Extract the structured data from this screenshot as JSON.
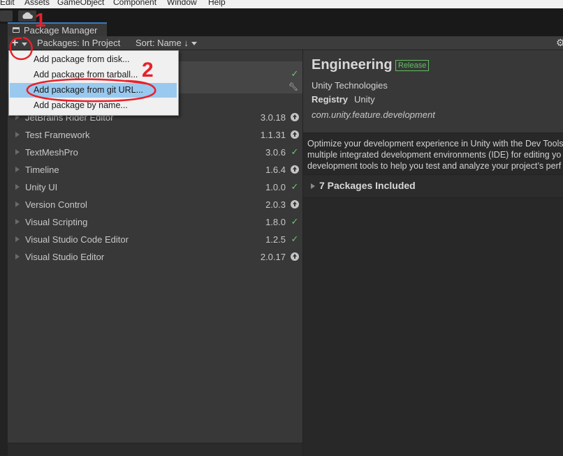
{
  "menubar": {
    "items": [
      "Edit",
      "Assets",
      "GameObject",
      "Component",
      "Window",
      "Help"
    ]
  },
  "window": {
    "title": "Package Manager"
  },
  "toolbar": {
    "add_label": "+",
    "packages_filter": "Packages: In Project",
    "sort_label": "Sort: Name ↓"
  },
  "menu": {
    "items": [
      {
        "label": "Add package from disk...",
        "highlighted": false
      },
      {
        "label": "Add package from tarball...",
        "highlighted": false
      },
      {
        "label": "Add package from git URL...",
        "highlighted": true
      },
      {
        "label": "Add package by name...",
        "highlighted": false
      }
    ]
  },
  "packages": [
    {
      "name": "JetBrains Rider Editor",
      "version": "3.0.18",
      "status": "update-icon"
    },
    {
      "name": "Test Framework",
      "version": "1.1.31",
      "status": "update-icon"
    },
    {
      "name": "TextMeshPro",
      "version": "3.0.6",
      "status": "check-icon"
    },
    {
      "name": "Timeline",
      "version": "1.6.4",
      "status": "update-icon"
    },
    {
      "name": "Unity UI",
      "version": "1.0.0",
      "status": "check-icon"
    },
    {
      "name": "Version Control",
      "version": "2.0.3",
      "status": "update-icon"
    },
    {
      "name": "Visual Scripting",
      "version": "1.8.0",
      "status": "check-icon"
    },
    {
      "name": "Visual Studio Code Editor",
      "version": "1.2.5",
      "status": "check-icon"
    },
    {
      "name": "Visual Studio Editor",
      "version": "2.0.17",
      "status": "update-icon"
    }
  ],
  "details": {
    "title": "Engineering",
    "badge": "Release",
    "author": "Unity Technologies",
    "registry_label": "Registry",
    "registry_value": "Unity",
    "package_id": "com.unity.feature.development",
    "description_lines": [
      "Optimize your development experience in Unity with the Dev Tools",
      "multiple integrated development environments (IDE) for editing yo",
      "development tools to help you test and analyze your project’s perf"
    ],
    "included_label": "7 Packages Included"
  },
  "annotations": {
    "marks": [
      "1",
      "2"
    ],
    "color": "#e8202a"
  },
  "colors": {
    "accent": "#3a79bb",
    "badge": "#5fc05f",
    "highlight": "#99c9ef"
  }
}
